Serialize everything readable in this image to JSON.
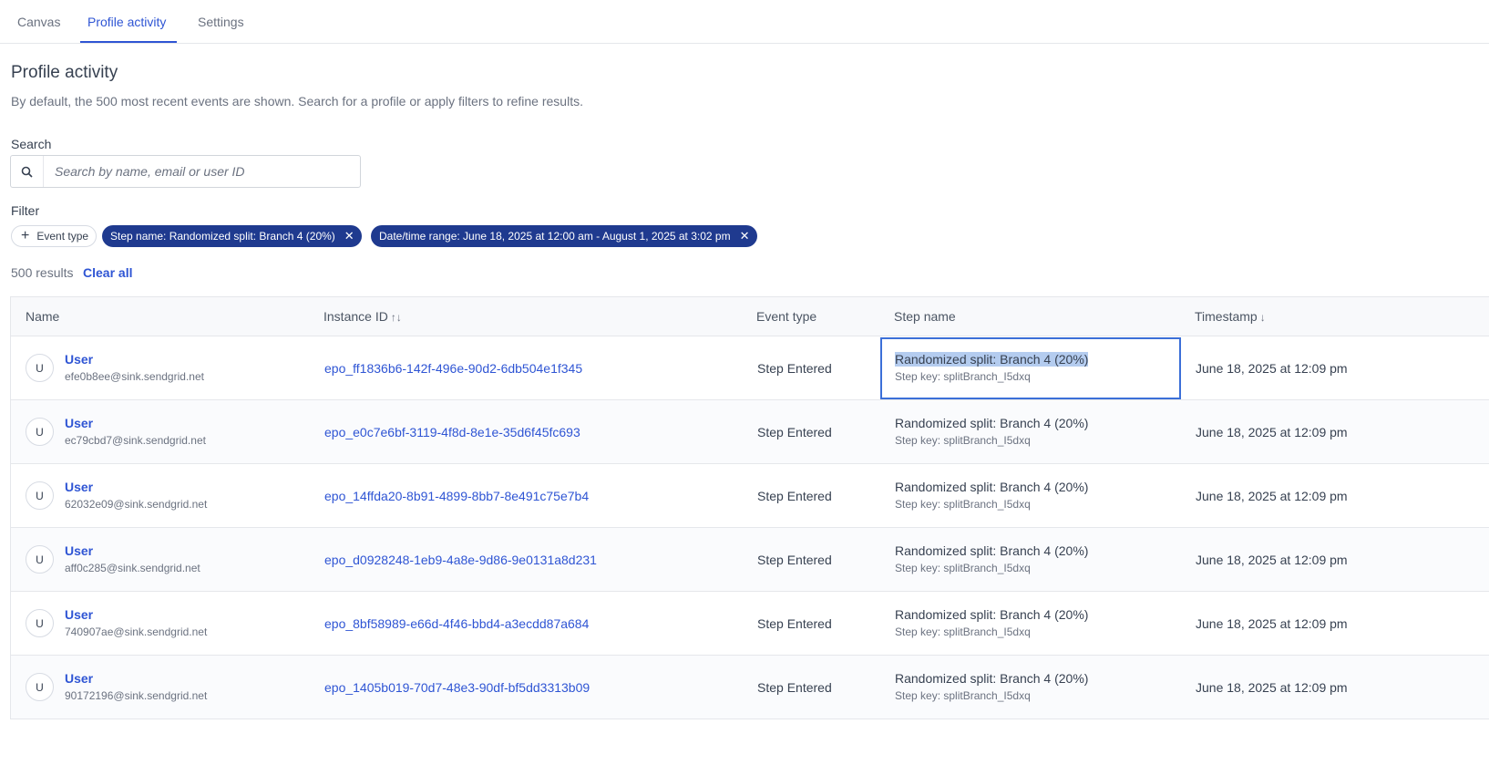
{
  "tabs": [
    {
      "label": "Canvas"
    },
    {
      "label": "Profile activity",
      "active": true
    },
    {
      "label": "Settings"
    }
  ],
  "page": {
    "title": "Profile activity",
    "description": "By default, the 500 most recent events are shown. Search for a profile or apply filters to refine results."
  },
  "search": {
    "label": "Search",
    "placeholder": "Search by name, email or user ID",
    "value": ""
  },
  "filter": {
    "label": "Filter",
    "add_label": "Event type",
    "chips": [
      {
        "label": "Step name: Randomized split: Branch 4 (20%)"
      },
      {
        "label": "Date/time range: June 18, 2025 at 12:00 am - August 1, 2025 at 3:02 pm"
      }
    ]
  },
  "results": {
    "count_text": "500 results",
    "clear_label": "Clear all"
  },
  "table": {
    "columns": [
      "Name",
      "Instance ID",
      "Event type",
      "Step name",
      "Timestamp"
    ],
    "sort_icons": {
      "instance": "↑↓",
      "timestamp": "↓"
    },
    "rows": [
      {
        "avatar": "U",
        "name": "User",
        "email": "efe0b8ee@sink.sendgrid.net",
        "instance": "epo_ff1836b6-142f-496e-90d2-6db504e1f345",
        "event": "Step Entered",
        "step": "Randomized split: Branch 4 (20%)",
        "step_key": "Step key: splitBranch_I5dxq",
        "timestamp": "June 18, 2025 at 12:09 pm"
      },
      {
        "avatar": "U",
        "name": "User",
        "email": "ec79cbd7@sink.sendgrid.net",
        "instance": "epo_e0c7e6bf-3119-4f8d-8e1e-35d6f45fc693",
        "event": "Step Entered",
        "step": "Randomized split: Branch 4 (20%)",
        "step_key": "Step key: splitBranch_I5dxq",
        "timestamp": "June 18, 2025 at 12:09 pm"
      },
      {
        "avatar": "U",
        "name": "User",
        "email": "62032e09@sink.sendgrid.net",
        "instance": "epo_14ffda20-8b91-4899-8bb7-8e491c75e7b4",
        "event": "Step Entered",
        "step": "Randomized split: Branch 4 (20%)",
        "step_key": "Step key: splitBranch_I5dxq",
        "timestamp": "June 18, 2025 at 12:09 pm"
      },
      {
        "avatar": "U",
        "name": "User",
        "email": "aff0c285@sink.sendgrid.net",
        "instance": "epo_d0928248-1eb9-4a8e-9d86-9e0131a8d231",
        "event": "Step Entered",
        "step": "Randomized split: Branch 4 (20%)",
        "step_key": "Step key: splitBranch_I5dxq",
        "timestamp": "June 18, 2025 at 12:09 pm"
      },
      {
        "avatar": "U",
        "name": "User",
        "email": "740907ae@sink.sendgrid.net",
        "instance": "epo_8bf58989-e66d-4f46-bbd4-a3ecdd87a684",
        "event": "Step Entered",
        "step": "Randomized split: Branch 4 (20%)",
        "step_key": "Step key: splitBranch_I5dxq",
        "timestamp": "June 18, 2025 at 12:09 pm"
      },
      {
        "avatar": "U",
        "name": "User",
        "email": "90172196@sink.sendgrid.net",
        "instance": "epo_1405b019-70d7-48e3-90df-bf5dd3313b09",
        "event": "Step Entered",
        "step": "Randomized split: Branch 4 (20%)",
        "step_key": "Step key: splitBranch_I5dxq",
        "timestamp": "June 18, 2025 at 12:09 pm"
      }
    ]
  },
  "colors": {
    "accent": "#2f55d4",
    "chip_bg": "#1f3a8f",
    "selection": "#b4ccef"
  }
}
